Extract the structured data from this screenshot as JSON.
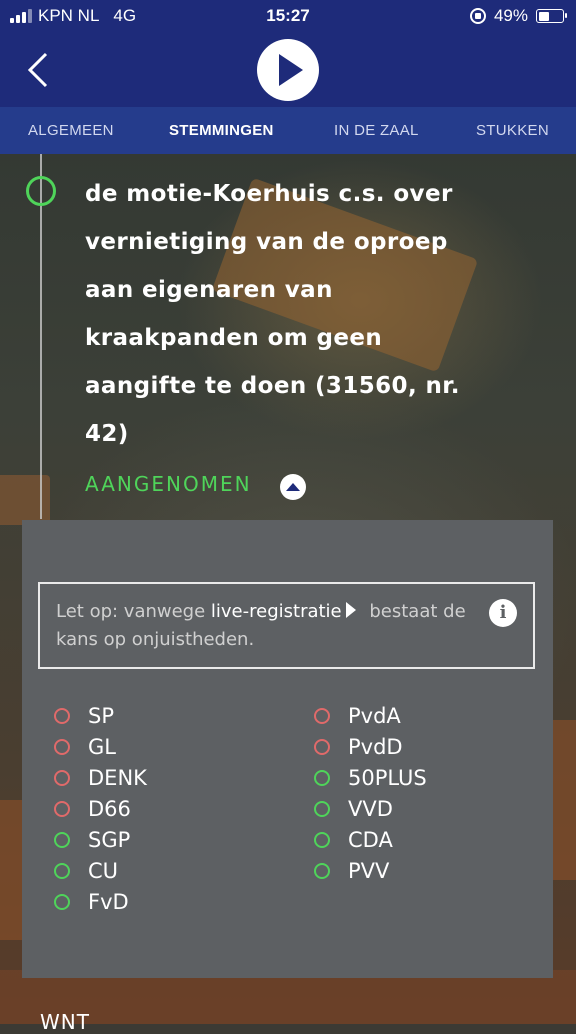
{
  "status_bar": {
    "carrier": "KPN NL",
    "network": "4G",
    "time": "15:27",
    "battery": "49%",
    "battery_level": 0.49
  },
  "tabs": [
    {
      "label": "ALGEMEEN",
      "active": false
    },
    {
      "label": "STEMMINGEN",
      "active": true
    },
    {
      "label": "IN DE ZAAL",
      "active": false
    },
    {
      "label": "STUKKEN",
      "active": false
    }
  ],
  "motion": {
    "lines": [
      "de motie-Koerhuis c.s. over",
      "vernietiging van de oproep",
      "aan eigenaren van",
      "kraakpanden om geen",
      "aangifte te doen (31560, nr.",
      "42)"
    ],
    "result": "AANGENOMEN"
  },
  "notice": {
    "prefix": "Let op: vanwege ",
    "link": "live-registratie",
    "suffix": " bestaat de kans op onjuistheden."
  },
  "colors": {
    "against": "#e06a6a",
    "for": "#4fd45a",
    "header": "#1e2b7a",
    "tabs": "#253c8c"
  },
  "votes": {
    "left": [
      {
        "party": "SP",
        "vote": "against"
      },
      {
        "party": "GL",
        "vote": "against"
      },
      {
        "party": "DENK",
        "vote": "against"
      },
      {
        "party": "D66",
        "vote": "against"
      },
      {
        "party": "SGP",
        "vote": "for"
      },
      {
        "party": "CU",
        "vote": "for"
      },
      {
        "party": "FvD",
        "vote": "for"
      }
    ],
    "right": [
      {
        "party": "PvdA",
        "vote": "against"
      },
      {
        "party": "PvdD",
        "vote": "against"
      },
      {
        "party": "50PLUS",
        "vote": "for"
      },
      {
        "party": "VVD",
        "vote": "for"
      },
      {
        "party": "CDA",
        "vote": "for"
      },
      {
        "party": "PVV",
        "vote": "for"
      }
    ]
  },
  "next_item_label": "WNT",
  "icons": {
    "back": "chevron-left-icon",
    "play": "play-icon",
    "toggle": "chevron-up-icon",
    "info": "info-icon"
  }
}
